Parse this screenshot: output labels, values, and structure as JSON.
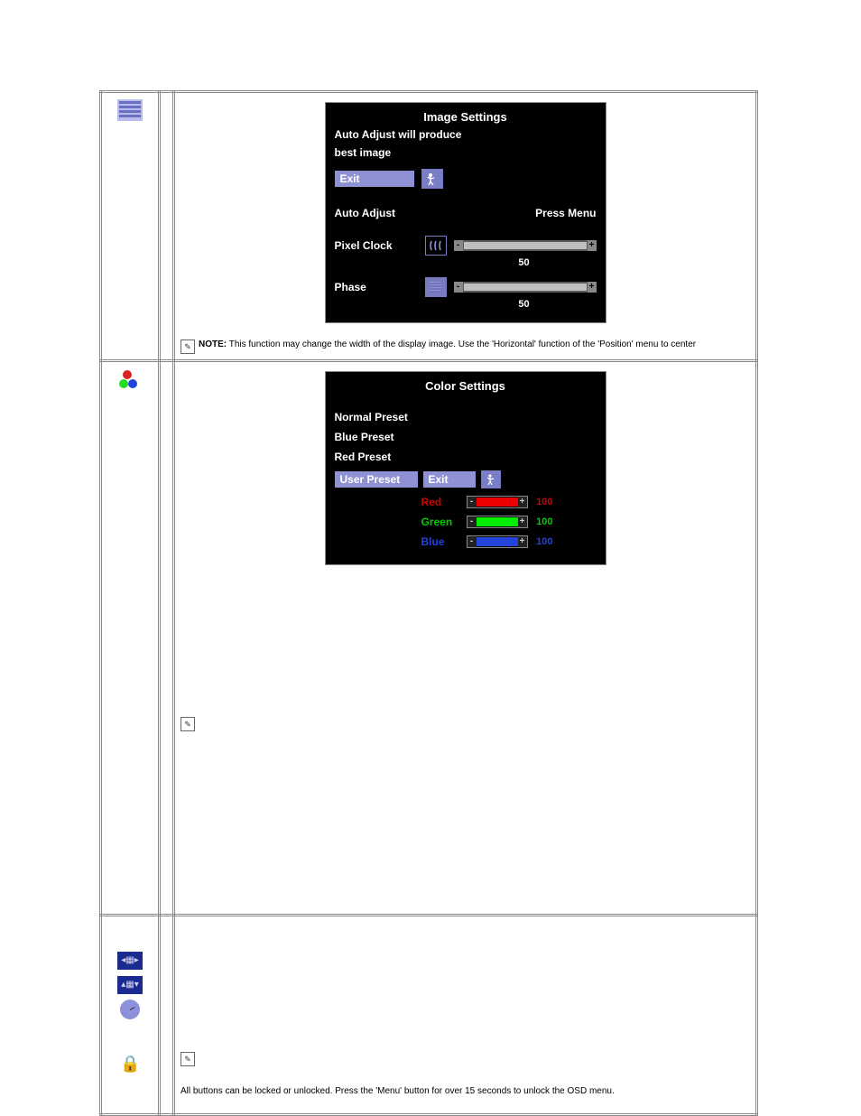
{
  "image_settings": {
    "title": "Image Settings",
    "message_l1": "Auto Adjust will produce",
    "message_l2": "best image",
    "exit_label": "Exit",
    "auto_adjust_label": "Auto Adjust",
    "press_menu_label": "Press Menu",
    "pixel_clock_label": "Pixel Clock",
    "pixel_clock_value": "50",
    "phase_label": "Phase",
    "phase_value": "50",
    "note_prefix": "NOTE:",
    "note_text": "This function may change the width of the display image. Use the 'Horizontal' function of the 'Position' menu to center"
  },
  "color_settings": {
    "title": "Color Settings",
    "normal_preset": "Normal Preset",
    "blue_preset": "Blue Preset",
    "red_preset": "Red Preset",
    "user_preset": "User Preset",
    "exit_label": "Exit",
    "red_label": "Red",
    "red_value": "100",
    "green_label": "Green",
    "green_value": "100",
    "blue_label": "Blue",
    "blue_value": "100"
  },
  "lock_note": "All buttons can be locked or unlocked. Press the 'Menu' button for over 15 seconds to unlock the OSD menu."
}
